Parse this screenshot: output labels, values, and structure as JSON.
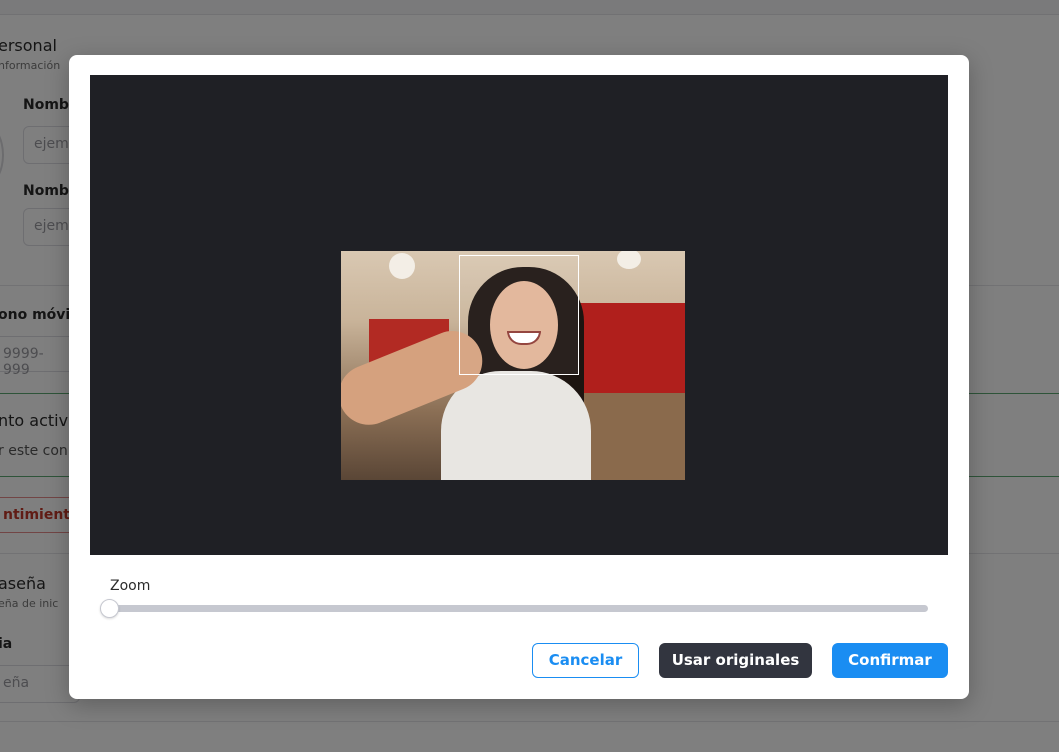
{
  "background": {
    "section_title": "ersonal",
    "section_subtitle": "nformación",
    "field1_label": "Nombr",
    "field1_placeholder": "ejem",
    "field2_label": "Nombr",
    "field2_placeholder": "ejem",
    "phone_label": "ono móvil",
    "phone_placeholder": "9999-999",
    "account_title": "nto activ",
    "account_text": "r este con",
    "danger_button": "ntimiento",
    "password_title": "aseña",
    "password_subtitle": "eña de inic",
    "password_label": "ia",
    "password_placeholder": "eña"
  },
  "modal": {
    "zoom_label": "Zoom",
    "zoom_value": 0,
    "buttons": {
      "cancel": "Cancelar",
      "use_original": "Usar originales",
      "confirm": "Confirmar"
    }
  },
  "colors": {
    "primary": "#1a8df2",
    "dark_button": "#32353f",
    "crop_background": "#1f2025"
  }
}
